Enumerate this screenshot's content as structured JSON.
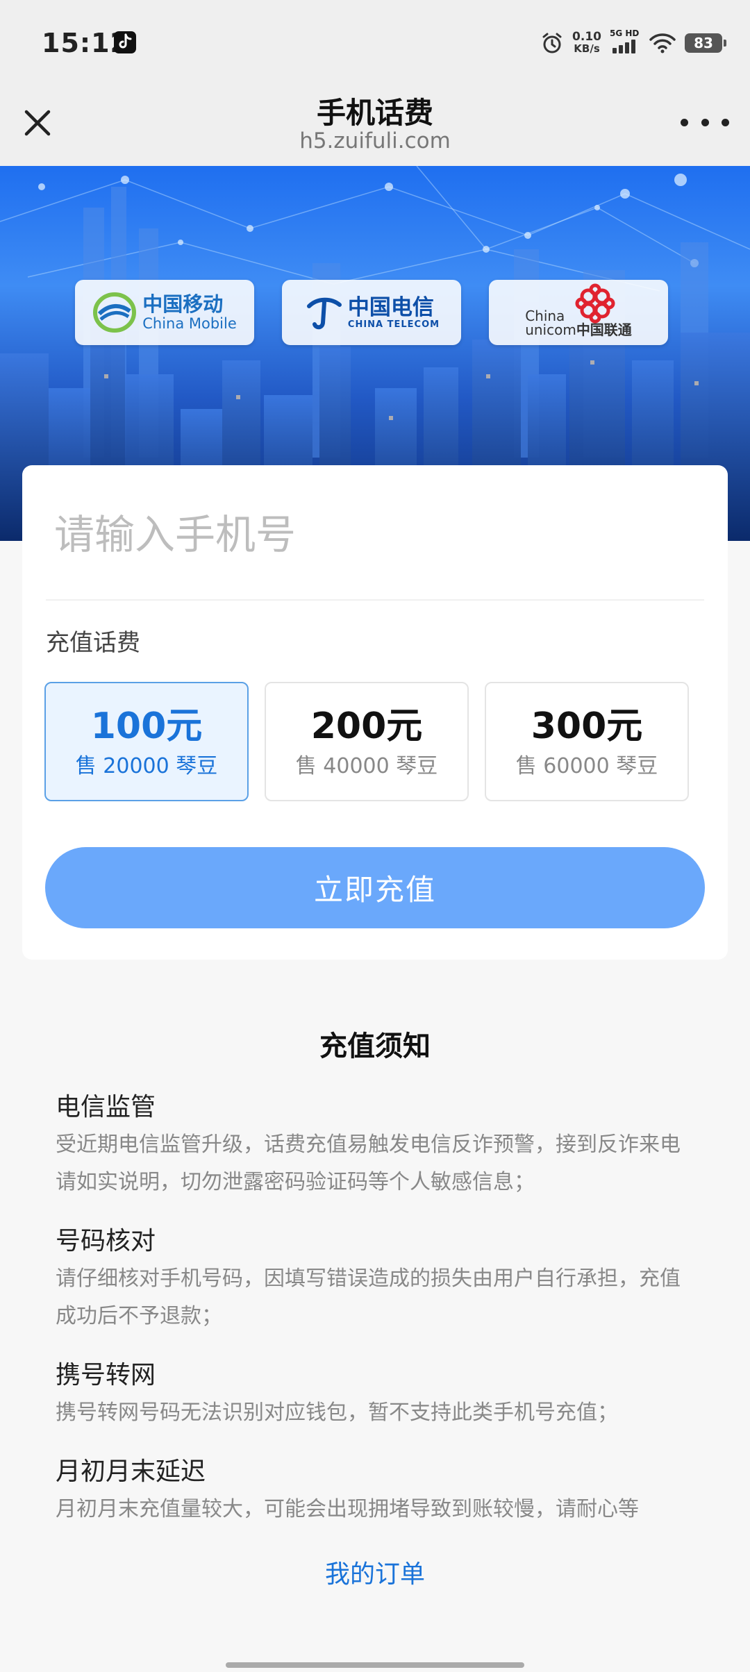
{
  "status_bar": {
    "time": "15:12",
    "net_speed_value": "0.10",
    "net_speed_unit": "KB/s",
    "signal_label": "5G HD",
    "battery": "83",
    "icons": [
      "tiktok-icon",
      "alarm-icon",
      "signal-icon",
      "wifi-icon",
      "battery-icon"
    ]
  },
  "nav": {
    "title": "手机话费",
    "subtitle": "h5.zuifuli.com",
    "close_icon": "close-icon",
    "more_icon": "more-icon"
  },
  "banner": {
    "carriers": [
      {
        "name_cn": "中国移动",
        "name_en": "China Mobile",
        "color": "#1b6fc1"
      },
      {
        "name_cn": "中国电信",
        "name_en": "CHINA TELECOM",
        "color": "#0d4fa8"
      },
      {
        "name_en_1": "China",
        "name_en_2": "unicom",
        "name_cn": "中国联通",
        "color": "#e0232f"
      }
    ]
  },
  "form": {
    "phone_placeholder": "请输入手机号",
    "phone_value": "",
    "section_label": "充值话费",
    "options": [
      {
        "amount": "100元",
        "price": "售 20000 琴豆",
        "selected": true
      },
      {
        "amount": "200元",
        "price": "售 40000 琴豆",
        "selected": false
      },
      {
        "amount": "300元",
        "price": "售 60000 琴豆",
        "selected": false
      }
    ],
    "submit_label": "立即充值"
  },
  "notice": {
    "title": "充值须知",
    "items": [
      {
        "heading": "电信监管",
        "body": "受近期电信监管升级，话费充值易触发电信反诈预警，接到反诈来电请如实说明，切勿泄露密码验证码等个人敏感信息；"
      },
      {
        "heading": "号码核对",
        "body": "请仔细核对手机号码，因填写错误造成的损失由用户自行承担，充值成功后不予退款；"
      },
      {
        "heading": "携号转网",
        "body": "携号转网号码无法识别对应钱包，暂不支持此类手机号充值；"
      },
      {
        "heading": "月初月末延迟",
        "body": "月初月末充值量较大，可能会出现拥堵导致到账较慢，请耐心等"
      }
    ]
  },
  "footer": {
    "my_orders_label": "我的订单"
  },
  "colors": {
    "accent": "#1a73d9",
    "button": "#6aa8fb",
    "selected_bg": "#eaf4ff"
  }
}
